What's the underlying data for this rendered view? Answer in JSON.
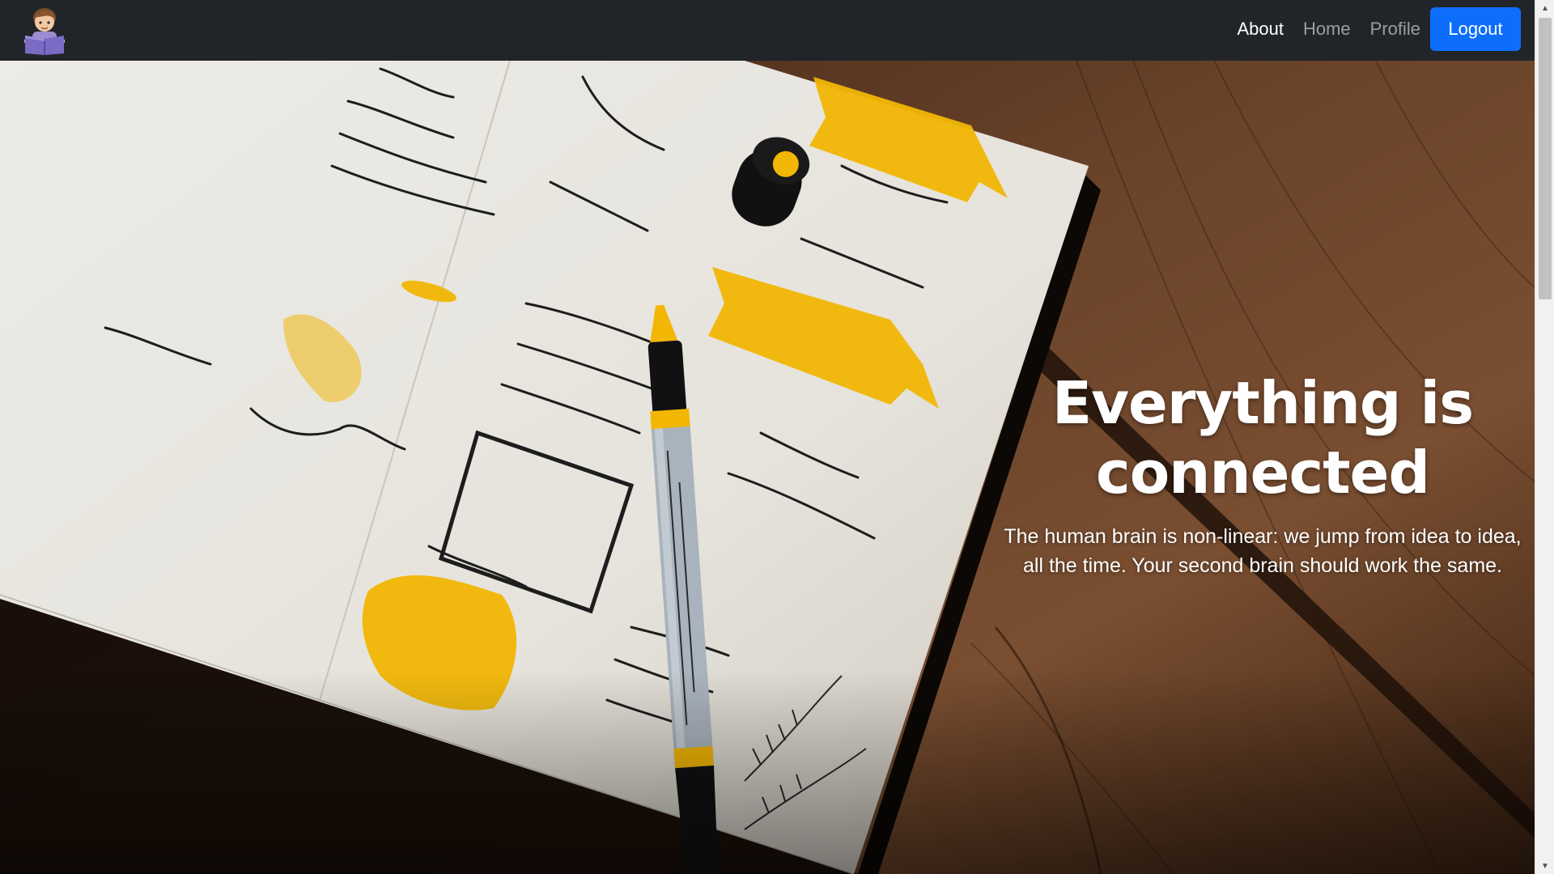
{
  "navbar": {
    "brand_icon": "reading-person-icon",
    "links": [
      {
        "label": "About",
        "active": true
      },
      {
        "label": "Home",
        "active": false
      },
      {
        "label": "Profile",
        "active": false
      }
    ],
    "logout_label": "Logout",
    "background": "#212529",
    "accent": "#0d6efd"
  },
  "hero": {
    "title_line1": "Everything is",
    "title_line2": "connected",
    "subtitle": "The human brain is non-linear: we jump from idea to idea, all the time. Your second brain should work the same.",
    "background_image": "notebook-bullet-journal-on-wooden-table"
  },
  "colors": {
    "wood": "#5a3a24",
    "paper": "#efece6",
    "highlight_yellow": "#f2b705",
    "scrollbar_track": "#f1f1f1",
    "scrollbar_thumb": "#c1c1c1"
  }
}
